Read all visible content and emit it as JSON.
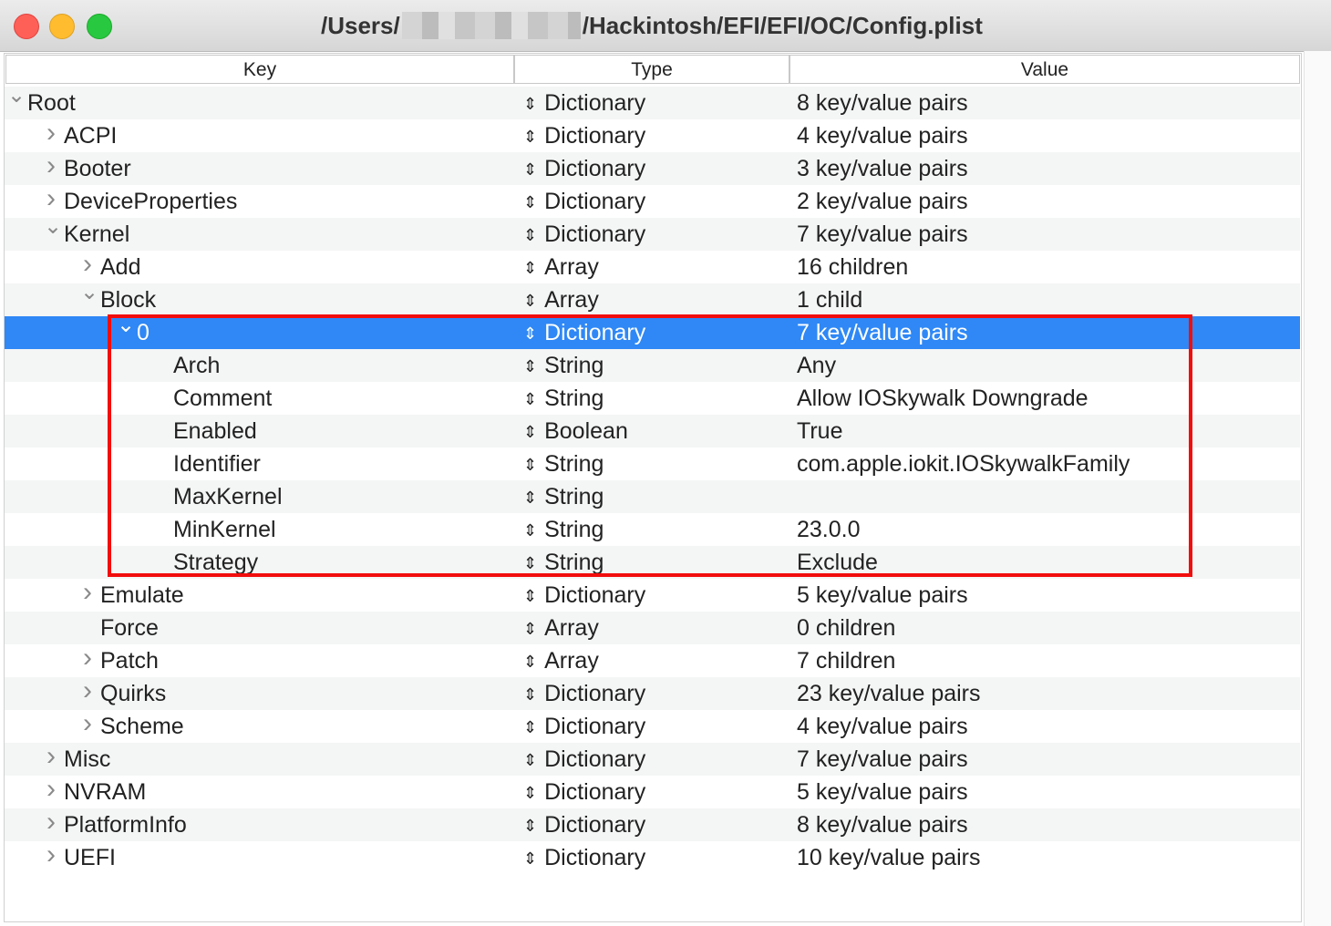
{
  "window": {
    "title_prefix": "/Users/",
    "title_suffix": "/Hackintosh/EFI/EFI/OC/Config.plist"
  },
  "columns": {
    "key": "Key",
    "type": "Type",
    "value": "Value"
  },
  "rows": [
    {
      "key": "Root",
      "type": "Dictionary",
      "value": "8 key/value pairs",
      "level": 0,
      "disclosure": "expanded"
    },
    {
      "key": "ACPI",
      "type": "Dictionary",
      "value": "4 key/value pairs",
      "level": 1,
      "disclosure": "collapsed"
    },
    {
      "key": "Booter",
      "type": "Dictionary",
      "value": "3 key/value pairs",
      "level": 1,
      "disclosure": "collapsed"
    },
    {
      "key": "DeviceProperties",
      "type": "Dictionary",
      "value": "2 key/value pairs",
      "level": 1,
      "disclosure": "collapsed"
    },
    {
      "key": "Kernel",
      "type": "Dictionary",
      "value": "7 key/value pairs",
      "level": 1,
      "disclosure": "expanded"
    },
    {
      "key": "Add",
      "type": "Array",
      "value": "16 children",
      "level": 2,
      "disclosure": "collapsed"
    },
    {
      "key": "Block",
      "type": "Array",
      "value": "1 child",
      "level": 2,
      "disclosure": "expanded"
    },
    {
      "key": "0",
      "type": "Dictionary",
      "value": "7 key/value pairs",
      "level": 3,
      "disclosure": "expanded",
      "selected": true
    },
    {
      "key": "Arch",
      "type": "String",
      "value": "Any",
      "level": 4,
      "disclosure": "none"
    },
    {
      "key": "Comment",
      "type": "String",
      "value": "Allow IOSkywalk Downgrade",
      "level": 4,
      "disclosure": "none"
    },
    {
      "key": "Enabled",
      "type": "Boolean",
      "value": "True",
      "level": 4,
      "disclosure": "none"
    },
    {
      "key": "Identifier",
      "type": "String",
      "value": "com.apple.iokit.IOSkywalkFamily",
      "level": 4,
      "disclosure": "none"
    },
    {
      "key": "MaxKernel",
      "type": "String",
      "value": "",
      "level": 4,
      "disclosure": "none"
    },
    {
      "key": "MinKernel",
      "type": "String",
      "value": "23.0.0",
      "level": 4,
      "disclosure": "none"
    },
    {
      "key": "Strategy",
      "type": "String",
      "value": "Exclude",
      "level": 4,
      "disclosure": "none"
    },
    {
      "key": "Emulate",
      "type": "Dictionary",
      "value": "5 key/value pairs",
      "level": 2,
      "disclosure": "collapsed"
    },
    {
      "key": "Force",
      "type": "Array",
      "value": "0 children",
      "level": 2,
      "disclosure": "none"
    },
    {
      "key": "Patch",
      "type": "Array",
      "value": "7 children",
      "level": 2,
      "disclosure": "collapsed"
    },
    {
      "key": "Quirks",
      "type": "Dictionary",
      "value": "23 key/value pairs",
      "level": 2,
      "disclosure": "collapsed"
    },
    {
      "key": "Scheme",
      "type": "Dictionary",
      "value": "4 key/value pairs",
      "level": 2,
      "disclosure": "collapsed"
    },
    {
      "key": "Misc",
      "type": "Dictionary",
      "value": "7 key/value pairs",
      "level": 1,
      "disclosure": "collapsed"
    },
    {
      "key": "NVRAM",
      "type": "Dictionary",
      "value": "5 key/value pairs",
      "level": 1,
      "disclosure": "collapsed"
    },
    {
      "key": "PlatformInfo",
      "type": "Dictionary",
      "value": "8 key/value pairs",
      "level": 1,
      "disclosure": "collapsed"
    },
    {
      "key": "UEFI",
      "type": "Dictionary",
      "value": "10 key/value pairs",
      "level": 1,
      "disclosure": "collapsed"
    }
  ],
  "colors": {
    "selection": "#2f88f5",
    "highlight_box": "#f20d0d",
    "alt_row": "#f4f5f5"
  },
  "icons": {
    "expanded": "chevron-down-icon",
    "collapsed": "chevron-right-icon",
    "type_selector": "up-down-arrows-icon"
  }
}
